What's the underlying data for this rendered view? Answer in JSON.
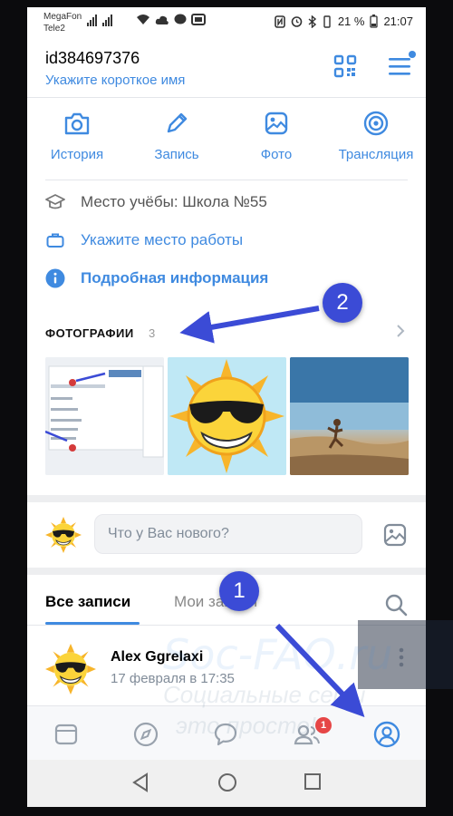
{
  "status_bar": {
    "carrier1": "MegaFon",
    "carrier2": "Tele2",
    "battery": "21 %",
    "time": "21:07"
  },
  "header": {
    "user_id": "id384697376",
    "short_name_prompt": "Укажите короткое имя",
    "icons": [
      "qr-code-icon",
      "menu-icon"
    ]
  },
  "actions": [
    {
      "label": "История",
      "icon": "camera-icon"
    },
    {
      "label": "Запись",
      "icon": "pencil-icon"
    },
    {
      "label": "Фото",
      "icon": "image-icon"
    },
    {
      "label": "Трансляция",
      "icon": "broadcast-icon"
    }
  ],
  "info": {
    "education": "Место учёбы: Школа №55",
    "work": "Укажите место работы",
    "more": "Подробная информация"
  },
  "photos": {
    "title": "ФОТОГРАФИИ",
    "count": "3"
  },
  "composer": {
    "placeholder": "Что у Вас нового?"
  },
  "tabs": {
    "all": "Все записи",
    "mine": "Мои записи"
  },
  "post": {
    "author": "Alex Ggrelaxi",
    "date": "17 февраля в 17:35"
  },
  "bottom_nav": {
    "items": [
      "news-icon",
      "explore-icon",
      "messages-icon",
      "friends-icon",
      "profile-icon"
    ],
    "friends_badge": "1"
  },
  "annotations": {
    "step1": "1",
    "step2": "2"
  },
  "watermark": {
    "site": "Soc-FAQ.ru",
    "line1": "Социальные сети",
    "line2": "это просто!"
  },
  "colors": {
    "accent": "#3f8ae0",
    "badge": "#e64646",
    "annotation": "#3b4bd6"
  }
}
